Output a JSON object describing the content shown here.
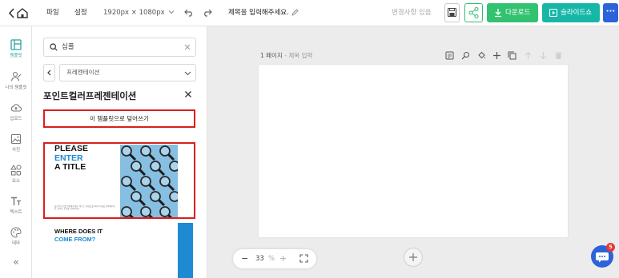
{
  "topbar": {
    "menu_file": "파일",
    "menu_settings": "설정",
    "canvas_size": "1920px × 1080px",
    "doc_title": "제목을 입력해주세요.",
    "changes_status": "변경사항 있음",
    "download_label": "다운로드",
    "slideshow_label": "슬라이드쇼",
    "more_label": "···"
  },
  "rail": {
    "items": [
      {
        "label": "템플릿",
        "icon": "layout-icon"
      },
      {
        "label": "나의 템플릿",
        "icon": "user-template-icon"
      },
      {
        "label": "업로드",
        "icon": "upload-cloud-icon"
      },
      {
        "label": "사진",
        "icon": "image-icon"
      },
      {
        "label": "요소",
        "icon": "shapes-icon"
      },
      {
        "label": "텍스트",
        "icon": "text-icon"
      },
      {
        "label": "테마",
        "icon": "palette-icon"
      }
    ],
    "collapse_label": "«"
  },
  "panel": {
    "search_value": "심플",
    "filter_value": "프레젠테이션",
    "title": "포인트컬러프레젠테이션",
    "overwrite_button": "이 템플릿으로 덮어쓰기",
    "template1": {
      "line1": "PLEASE",
      "line2": "ENTER",
      "line3": "A TITLE",
      "small_text": "불릿 텍스트를 입력해주세요. 텍스트 상자를 클릭하여 내용을 입력해주세요. 원하는 문구를 입력하세요."
    },
    "template2": {
      "line1": "WHERE DOES IT",
      "line2": "COME FROM?"
    }
  },
  "canvas": {
    "page_number": "1 페이지",
    "page_title_placeholder": " - 제목 입력",
    "zoom_value": "33",
    "zoom_unit": "%"
  },
  "chat": {
    "badge_count": "5"
  },
  "colors": {
    "accent_green": "#33c26f",
    "accent_teal": "#17b7a7",
    "accent_blue": "#2d63d9",
    "highlight_red": "#d9201e",
    "template_blue": "#1e8ad2"
  }
}
